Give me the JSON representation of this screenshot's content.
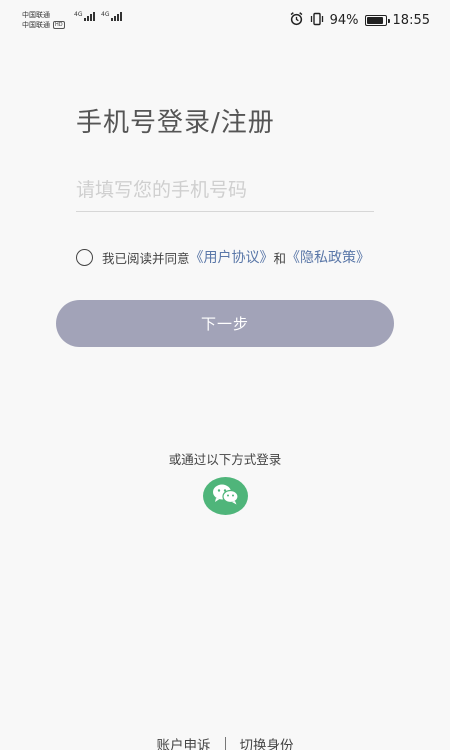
{
  "status_bar": {
    "carrier_1": "中国联通",
    "carrier_2": "中国联通",
    "hd_badge": "HD",
    "network_1": "4G",
    "network_2": "4G",
    "battery_text": "94%",
    "battery_level": 0.94,
    "time": "18:55",
    "icons": [
      "alarm-icon",
      "vibrate-icon",
      "battery-icon",
      "signal-icon"
    ]
  },
  "login": {
    "title": "手机号登录/注册",
    "phone_placeholder": "请填写您的手机号码",
    "phone_value": "",
    "agreement_prefix": "我已阅读并同意",
    "user_agreement": "《用户协议》",
    "and_text": "和",
    "privacy_policy": "《隐私政策》",
    "agreement_checked": false,
    "next_label": "下一步"
  },
  "alt_login": {
    "label": "或通过以下方式登录",
    "wechat_icon": "wechat-icon"
  },
  "footer": {
    "appeal": "账户申诉",
    "switch_identity": "切换身份"
  },
  "colors": {
    "background": "#f8f8f8",
    "button": "#a2a3b8",
    "link": "#5a77a8",
    "wechat": "#4fb57a"
  }
}
